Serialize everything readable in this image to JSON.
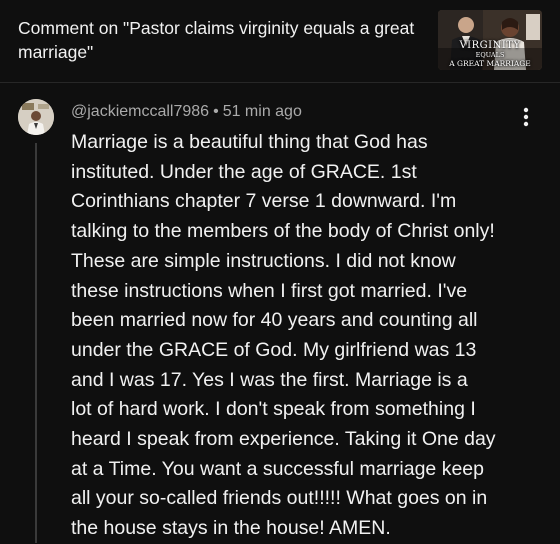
{
  "header": {
    "title": "Comment on \"Pastor claims virginity equals a great marriage\"",
    "thumbnail": {
      "line1": "VIRGINITY",
      "line2": "EQUALS",
      "line3": "A GREAT MARRIAGE"
    }
  },
  "comment": {
    "author": "@jackiemccall7986",
    "separator": "•",
    "timestamp": "51 min ago",
    "more_icon": "more-vert-icon",
    "body_lines": [
      "Marriage is a beautiful thing that God has",
      "instituted. Under the age of GRACE. 1st",
      "Corinthians chapter 7 verse 1 downward. I'm",
      "talking to the members of the body of Christ only!",
      "These are simple instructions. I did not know",
      "these instructions when I first got married. I've",
      "been married now for 40 years and counting all",
      "under the GRACE of God. My girlfriend was 13",
      "and I was 17. Yes I was the first. Marriage is a",
      "lot of hard work. I don't speak from something I",
      "heard I speak from experience. Taking it One day",
      "at a Time. You want a successful marriage keep",
      "all your so-called friends out!!!!! What goes on in",
      "the house stays in the house! AMEN."
    ]
  },
  "colors": {
    "background": "#0f0f0f",
    "text_primary": "#f1f1f1",
    "text_secondary": "#aaaaaa",
    "divider": "#272727",
    "thread_line": "#3a3a3a"
  }
}
